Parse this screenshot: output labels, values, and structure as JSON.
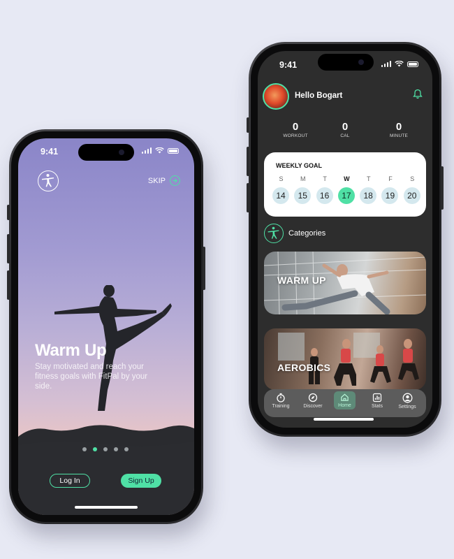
{
  "left_phone": {
    "status_time": "9:41",
    "skip_label": "SKIP",
    "onboarding": {
      "title": "Warm Up",
      "description": "Stay motivated and reach your fitness goals with FitPal by your side."
    },
    "pager": {
      "total": 5,
      "active_index": 1
    },
    "login_label": "Log In",
    "signup_label": "Sign Up",
    "accent_color": "#4fe0a5"
  },
  "right_phone": {
    "status_time": "9:41",
    "greeting": "Hello Bogart",
    "stats": [
      {
        "value": "0",
        "label": "WORKOUT"
      },
      {
        "value": "0",
        "label": "CAL"
      },
      {
        "value": "0",
        "label": "MINUTE"
      }
    ],
    "weekly_goal": {
      "title": "WEEKLY GOAL",
      "days": [
        {
          "letter": "S",
          "date": "14"
        },
        {
          "letter": "M",
          "date": "15"
        },
        {
          "letter": "T",
          "date": "16"
        },
        {
          "letter": "W",
          "date": "17",
          "today": true
        },
        {
          "letter": "T",
          "date": "18"
        },
        {
          "letter": "F",
          "date": "19"
        },
        {
          "letter": "S",
          "date": "20"
        }
      ]
    },
    "categories_label": "Categories",
    "category_cards": [
      {
        "title": "WARM UP"
      },
      {
        "title": "AEROBICS"
      }
    ],
    "tabs": [
      {
        "label": "Training",
        "icon": "stopwatch-icon"
      },
      {
        "label": "Discover",
        "icon": "compass-icon"
      },
      {
        "label": "Home",
        "icon": "home-icon",
        "active": true
      },
      {
        "label": "Stats",
        "icon": "bar-chart-icon"
      },
      {
        "label": "Settings",
        "icon": "user-circle-icon"
      }
    ]
  }
}
